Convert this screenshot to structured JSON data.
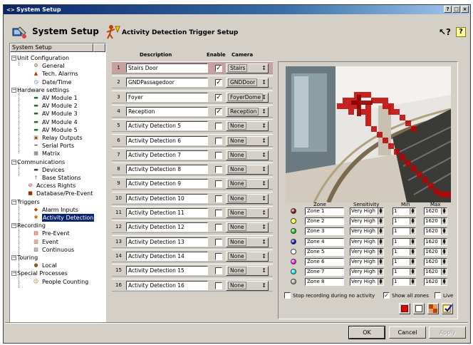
{
  "window": {
    "title": "System Setup",
    "buttons": [
      "?",
      "□",
      "×"
    ]
  },
  "header": {
    "app_title": "System Setup",
    "page_title": "Activity Detection Trigger Setup"
  },
  "tree": {
    "column_header": "System Setup",
    "items": [
      {
        "label": "Unit Configuration",
        "icon": "expand-minus"
      },
      {
        "label": "General",
        "icon": "gear-icon"
      },
      {
        "label": "Tech. Alarms",
        "icon": "alarm-icon"
      },
      {
        "label": "Date/Time",
        "icon": "clock-icon"
      },
      {
        "label": "Hardware settings",
        "icon": "expand-minus"
      },
      {
        "label": "AV Module 1",
        "icon": "module-icon"
      },
      {
        "label": "AV Module 2",
        "icon": "module-icon"
      },
      {
        "label": "AV Module 3",
        "icon": "module-icon"
      },
      {
        "label": "AV Module 4",
        "icon": "module-icon"
      },
      {
        "label": "AV Module 5",
        "icon": "module-icon"
      },
      {
        "label": "Relay Outputs",
        "icon": "relay-icon"
      },
      {
        "label": "Serial Ports",
        "icon": "serial-icon"
      },
      {
        "label": "Matrix",
        "icon": "matrix-icon"
      },
      {
        "label": "Communications",
        "icon": "expand-minus"
      },
      {
        "label": "Devices",
        "icon": "device-icon"
      },
      {
        "label": "Base Stations",
        "icon": "station-icon"
      },
      {
        "label": "Access Rights",
        "icon": "access-icon"
      },
      {
        "label": "Database/Pre-Event",
        "icon": "database-icon"
      },
      {
        "label": "Triggers",
        "icon": "expand-minus"
      },
      {
        "label": "Alarm Inputs",
        "icon": "alarm-input-icon"
      },
      {
        "label": "Activity Detection",
        "icon": "activity-icon"
      },
      {
        "label": "Recording",
        "icon": "expand-minus"
      },
      {
        "label": "Pre-Event",
        "icon": "pre-event-icon"
      },
      {
        "label": "Event",
        "icon": "event-icon"
      },
      {
        "label": "Continuous",
        "icon": "continuous-icon"
      },
      {
        "label": "Touring",
        "icon": "expand-minus"
      },
      {
        "label": "Local",
        "icon": "local-icon"
      },
      {
        "label": "Special Processes",
        "icon": "expand-minus"
      },
      {
        "label": "People Counting",
        "icon": "people-icon"
      }
    ]
  },
  "table": {
    "headers": {
      "description": "Description",
      "enable": "Enable",
      "camera": "Camera"
    },
    "rows": [
      {
        "num": "1",
        "desc": "Stairs Door",
        "enabled": true,
        "camera": "Stairs"
      },
      {
        "num": "2",
        "desc": "GNDPassagedoor",
        "enabled": true,
        "camera": "GNDDoor"
      },
      {
        "num": "3",
        "desc": "Foyer",
        "enabled": true,
        "camera": "FoyerDome"
      },
      {
        "num": "4",
        "desc": "Reception",
        "enabled": true,
        "camera": "Reception"
      },
      {
        "num": "5",
        "desc": "Activity Detection 5",
        "enabled": false,
        "camera": "None"
      },
      {
        "num": "6",
        "desc": "Activity Detection 6",
        "enabled": false,
        "camera": "None"
      },
      {
        "num": "7",
        "desc": "Activity Detection 7",
        "enabled": false,
        "camera": "None"
      },
      {
        "num": "8",
        "desc": "Activity Detection 8",
        "enabled": false,
        "camera": "None"
      },
      {
        "num": "9",
        "desc": "Activity Detection 9",
        "enabled": false,
        "camera": "None"
      },
      {
        "num": "10",
        "desc": "Activity Detection 10",
        "enabled": false,
        "camera": "None"
      },
      {
        "num": "11",
        "desc": "Activity Detection 11",
        "enabled": false,
        "camera": "None"
      },
      {
        "num": "12",
        "desc": "Activity Detection 12",
        "enabled": false,
        "camera": "None"
      },
      {
        "num": "13",
        "desc": "Activity Detection 13",
        "enabled": false,
        "camera": "None"
      },
      {
        "num": "14",
        "desc": "Activity Detection 14",
        "enabled": false,
        "camera": "None"
      },
      {
        "num": "15",
        "desc": "Activity Detection 15",
        "enabled": false,
        "camera": "None"
      },
      {
        "num": "16",
        "desc": "Activity Detection 16",
        "enabled": false,
        "camera": "None"
      }
    ]
  },
  "zones": {
    "headers": {
      "zone": "Zone",
      "sensitivity": "Sensitivity",
      "min": "Min",
      "max": "Max"
    },
    "rows": [
      {
        "name": "Zone 1",
        "color": "#8b0000",
        "sensitivity": "Very High",
        "min": "1",
        "max": "1620"
      },
      {
        "name": "Zone 2",
        "color": "#ffff00",
        "sensitivity": "Very High",
        "min": "1",
        "max": "1620"
      },
      {
        "name": "Zone 3",
        "color": "#00cc00",
        "sensitivity": "Very High",
        "min": "1",
        "max": "1620"
      },
      {
        "name": "Zone 4",
        "color": "#0000cc",
        "sensitivity": "Very High",
        "min": "1",
        "max": "1620"
      },
      {
        "name": "Zone 5",
        "color": "#ffffff",
        "sensitivity": "Very High",
        "min": "1",
        "max": "1620"
      },
      {
        "name": "Zone 6",
        "color": "#ff00ff",
        "sensitivity": "Very High",
        "min": "1",
        "max": "1620"
      },
      {
        "name": "Zone 7",
        "color": "#00e5e5",
        "sensitivity": "Very High",
        "min": "1",
        "max": "1620"
      },
      {
        "name": "Zone 8",
        "color": "#a0a0a0",
        "sensitivity": "Very High",
        "min": "1",
        "max": "1620"
      }
    ]
  },
  "options": {
    "stop_recording": "Stop recording during no activity",
    "show_all_zones": "Show all zones",
    "live": "Live",
    "stop_recording_checked": false,
    "show_all_zones_checked": true,
    "live_checked": false
  },
  "footer": {
    "ok": "OK",
    "cancel": "Cancel",
    "apply": "Apply"
  },
  "help": {
    "whats_this": "↖?",
    "help": "?"
  }
}
